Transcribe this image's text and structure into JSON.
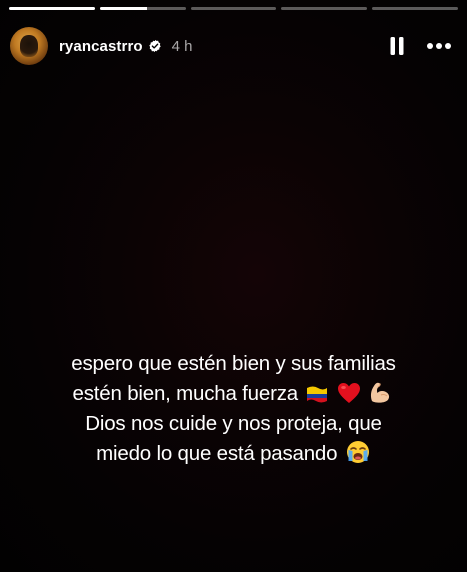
{
  "story": {
    "progress_segments": [
      {
        "fill_fraction": 1.0
      },
      {
        "fill_fraction": 0.55
      },
      {
        "fill_fraction": 0.0
      },
      {
        "fill_fraction": 0.0
      },
      {
        "fill_fraction": 0.0
      }
    ]
  },
  "header": {
    "username": "ryancastrro",
    "verified_icon": "verified-badge-icon",
    "time": "4 h",
    "pause_icon": "pause-icon",
    "more_icon": "more-options-icon"
  },
  "caption": {
    "line1": "espero que estén bien y sus familias",
    "line2": "estén bien, mucha fuerza",
    "line3": "Dios nos cuide y nos proteja, que",
    "line4": "miedo lo que está pasando"
  },
  "emojis": {
    "flag": "colombia-flag-icon",
    "heart": "red-heart-icon",
    "muscle": "flexed-biceps-icon",
    "crying": "loudly-crying-face-icon"
  }
}
